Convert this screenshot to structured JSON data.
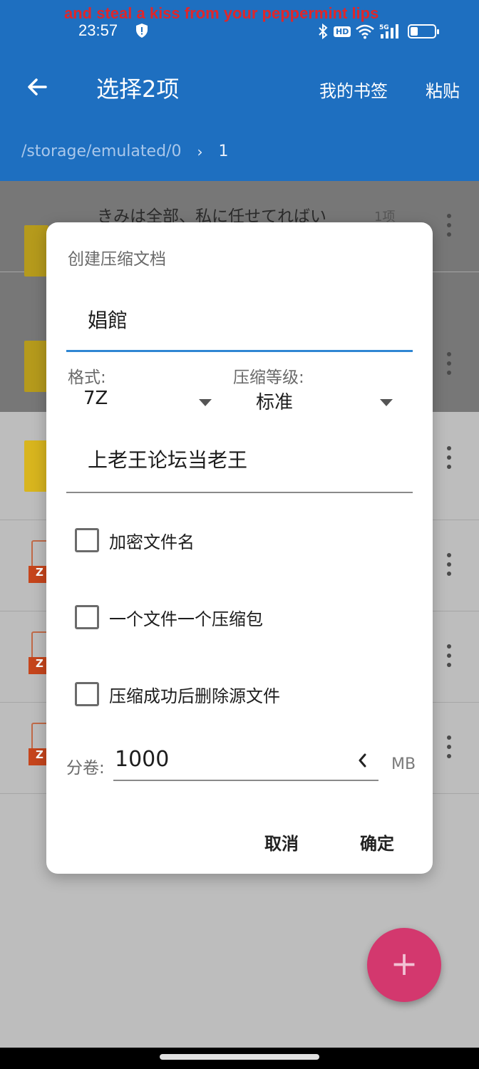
{
  "overlay_text": "and steal a kiss from your peppermint lips",
  "status_bar": {
    "time": "23:57",
    "hd_badge": "HD",
    "network": "5G",
    "icons": [
      "shield-icon",
      "bluetooth-icon",
      "wifi-icon",
      "signal-icon",
      "battery-icon"
    ]
  },
  "toolbar": {
    "title": "选择2项",
    "bookmarks": "我的书签",
    "paste": "粘贴"
  },
  "breadcrumb": {
    "root": "/storage/emulated/0",
    "current": "1"
  },
  "file_list": {
    "first_item_name": "きみは全部、私に任せてればい",
    "first_item_count": "1项",
    "zip_tag": "Z"
  },
  "dialog": {
    "title": "创建压缩文档",
    "archive_name": "娼館",
    "format_label": "格式:",
    "format_value": "7Z",
    "level_label": "压缩等级:",
    "level_value": "标准",
    "comment_value": "上老王论坛当老王",
    "checkboxes": [
      {
        "label": "加密文件名",
        "checked": false
      },
      {
        "label": "一个文件一个压缩包",
        "checked": false
      },
      {
        "label": "压缩成功后删除源文件",
        "checked": false
      }
    ],
    "split_label": "分卷:",
    "split_value": "1000",
    "split_unit": "MB",
    "cancel": "取消",
    "confirm": "确定"
  },
  "fab_label": "+",
  "colors": {
    "appbar": "#1e6fc0",
    "accent_underline": "#2f86d3",
    "fab": "#d3386e",
    "overlay_text": "#e0262a"
  }
}
